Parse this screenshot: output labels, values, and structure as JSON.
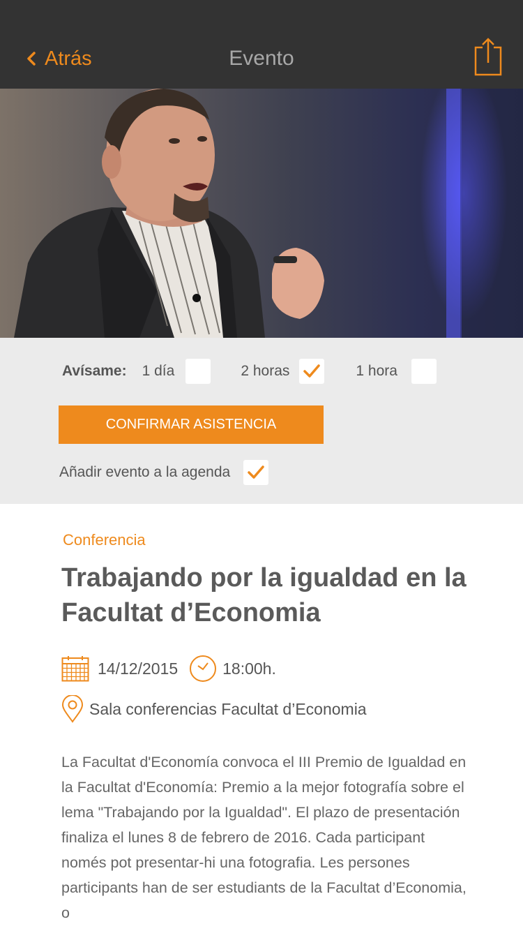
{
  "nav": {
    "back_label": "Atrás",
    "title": "Evento"
  },
  "reminders": {
    "label": "Avísame:",
    "options": [
      {
        "label": "1 día",
        "checked": false
      },
      {
        "label": "2 horas",
        "checked": true
      },
      {
        "label": "1 hora",
        "checked": false
      }
    ]
  },
  "confirm_label": "CONFIRMAR ASISTENCIA",
  "agenda": {
    "label": "Añadir evento a la agenda",
    "checked": true
  },
  "event": {
    "category": "Conferencia",
    "title": "Trabajando por la igualdad en la Facultat d’Economia",
    "date": "14/12/2015",
    "time": "18:00h.",
    "location": "Sala conferencias Facultat d’Economia",
    "description": "La Facultat d'Economía convoca el III Premio de Igualdad en la Facultat d'Economía: Premio a la mejor fotografía sobre el lema \"Trabajando por la Igualdad\". El plazo de presentación finaliza el lunes 8 de febrero de 2016. Cada participant només pot presentar-hi una fotografia. Les persones participants han de ser estudiants de la Facultat d’Economia, o"
  },
  "colors": {
    "accent": "#ee8a1d",
    "topbar": "#333333",
    "options_bg": "#ebebeb"
  },
  "icons": [
    "chevron-left-icon",
    "share-icon",
    "calendar-icon",
    "clock-icon",
    "location-pin-icon",
    "checkmark-icon"
  ]
}
